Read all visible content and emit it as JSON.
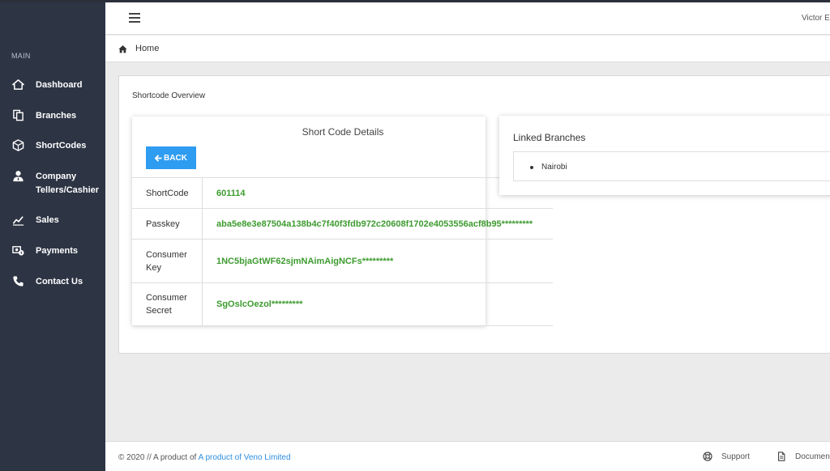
{
  "topbar": {
    "user_name": "Victor E"
  },
  "sidebar": {
    "section": "MAIN",
    "items": [
      {
        "label": "Dashboard",
        "icon": "home-icon"
      },
      {
        "label": "Branches",
        "icon": "copy-icon"
      },
      {
        "label": "ShortCodes",
        "icon": "cube-icon"
      },
      {
        "label": "Company Tellers/Cashier",
        "icon": "user-tie-icon"
      },
      {
        "label": "Sales",
        "icon": "chart-line-icon"
      },
      {
        "label": "Payments",
        "icon": "money-icon"
      },
      {
        "label": "Contact Us",
        "icon": "phone-icon"
      }
    ]
  },
  "breadcrumb": {
    "home": "Home"
  },
  "page": {
    "card_title": "Shortcode Overview"
  },
  "details": {
    "title": "Short Code Details",
    "back_label": "BACK",
    "rows": [
      {
        "key": "ShortCode",
        "value": "601114"
      },
      {
        "key": "Passkey",
        "value": "aba5e8e3e87504a138b4c7f40f3fdb972c20608f1702e4053556acf8b95*********"
      },
      {
        "key": "Consumer Key",
        "value": "1NC5bjaGtWF62sjmNAimAigNCFs*********"
      },
      {
        "key": "Consumer Secret",
        "value": "SgOslcOezol*********"
      }
    ]
  },
  "linked": {
    "title": "Linked Branches",
    "branches": [
      "Nairobi"
    ]
  },
  "footer": {
    "copyright_prefix": "© 2020 // A product of ",
    "company_link": "A product of Veno Limited",
    "support": "Support",
    "documentation": "Documen"
  },
  "colors": {
    "accent": "#2e9cf0",
    "sidebar": "#2d3444",
    "value_green": "#3d9b2f"
  }
}
